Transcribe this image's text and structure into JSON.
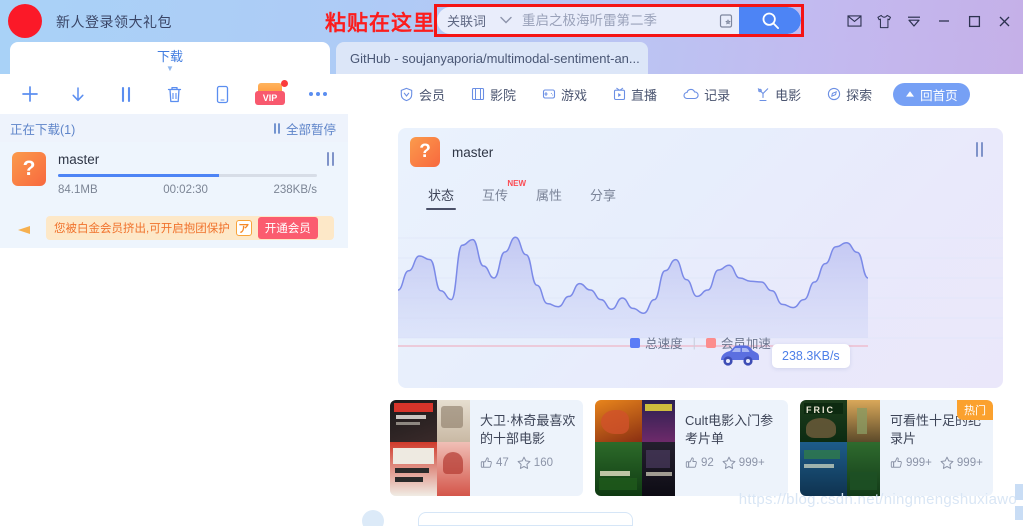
{
  "titlebar": {
    "promo_text": "新人登录领大礼包",
    "paste_hint": "粘贴在这里",
    "logo": "red-circle-logo"
  },
  "search": {
    "category": "关联词",
    "value": "",
    "placeholder": "重启之极海听雷第二季",
    "favorite_icon": "bookmark-star-icon",
    "go_icon": "search-icon"
  },
  "window_controls": [
    {
      "name": "mail-icon",
      "glyph": "✉"
    },
    {
      "name": "skin-tshirt-icon",
      "glyph": "👕"
    },
    {
      "name": "menu-chevron-icon",
      "glyph": "▽"
    },
    {
      "name": "minimize-icon",
      "glyph": "—"
    },
    {
      "name": "maximize-icon",
      "glyph": "▢"
    },
    {
      "name": "close-icon",
      "glyph": "✕"
    }
  ],
  "tabs": [
    {
      "label": "下载",
      "active": true
    },
    {
      "label": "GitHub - soujanyaporia/multimodal-sentiment-an...",
      "active": false
    }
  ],
  "left_panel": {
    "toolbar": [
      {
        "name": "add-task-button",
        "icon": "plus-icon"
      },
      {
        "name": "download-button",
        "icon": "arrow-down-icon"
      },
      {
        "name": "pause-button",
        "icon": "pause-icon"
      },
      {
        "name": "delete-button",
        "icon": "trash-icon"
      },
      {
        "name": "mobile-button",
        "icon": "phone-icon"
      },
      {
        "name": "vip-button",
        "icon": "vip-badge-icon",
        "label": "VIP"
      },
      {
        "name": "more-button",
        "icon": "ellipsis-icon"
      }
    ],
    "status_label": "正在下载(1)",
    "pause_all_label": "全部暂停",
    "download": {
      "icon_char": "?",
      "title": "master",
      "size": "84.1MB",
      "time": "00:02:30",
      "speed": "238KB/s",
      "progress_percent": 62,
      "pause_icon": "pause-icon"
    },
    "banner": {
      "text": "您被白金会员挤出,可开启抱团保护",
      "badge": "ア",
      "button_label": "开通会员"
    }
  },
  "nav": [
    {
      "label": "会员",
      "icon": "vip-shield-icon"
    },
    {
      "label": "影院",
      "icon": "film-icon"
    },
    {
      "label": "游戏",
      "icon": "gamepad-icon"
    },
    {
      "label": "直播",
      "icon": "live-tv-icon"
    },
    {
      "label": "记录",
      "icon": "cloud-icon"
    },
    {
      "label": "电影",
      "icon": "movie-icon"
    },
    {
      "label": "探索",
      "icon": "compass-icon"
    }
  ],
  "home_button": {
    "label": "回首页",
    "icon": "triangle-up-icon"
  },
  "task_card": {
    "icon_char": "?",
    "title": "master",
    "pause_icon": "pause-icon",
    "tabs": [
      {
        "label": "状态",
        "active": true,
        "badge": ""
      },
      {
        "label": "互传",
        "active": false,
        "badge": "NEW"
      },
      {
        "label": "属性",
        "active": false,
        "badge": ""
      },
      {
        "label": "分享",
        "active": false,
        "badge": ""
      }
    ],
    "speed_bubble": "238.3KB/s",
    "car_icon": "car-icon"
  },
  "chart_data": {
    "type": "area",
    "title": "",
    "xlabel": "",
    "ylabel": "",
    "legend": [
      {
        "label": "总速度",
        "color": "#5b7cf6"
      },
      {
        "label": "会员加速",
        "color": "#fc8d8d"
      }
    ],
    "legend_position": "bottom",
    "grid": true,
    "ylim": [
      0,
      300
    ],
    "current_value": 238.3,
    "unit": "KB/s",
    "series": [
      {
        "name": "总速度",
        "color": "#5b7cf6",
        "values": [
          120,
          168,
          205,
          196,
          118,
          96,
          232,
          246,
          180,
          150,
          215,
          252,
          208,
          132,
          86,
          78,
          104,
          136,
          120,
          96,
          72,
          100,
          74,
          62,
          96,
          168,
          196,
          146,
          104,
          120,
          170,
          182,
          150,
          142,
          140,
          118,
          84,
          76,
          96,
          140,
          186,
          228,
          238,
          214,
          150
        ]
      },
      {
        "name": "会员加速",
        "color": "#fc8d8d",
        "values": [
          0,
          0,
          0,
          0,
          0,
          0,
          0,
          0,
          0,
          0,
          0,
          0,
          0,
          0,
          0,
          0,
          0,
          0,
          0,
          0,
          0,
          0,
          0,
          0,
          0,
          0,
          0,
          0,
          0,
          0,
          0,
          0,
          0,
          0,
          0,
          0,
          0,
          0,
          0,
          0,
          0,
          0,
          0,
          0,
          0
        ]
      }
    ]
  },
  "movie_cards": [
    {
      "title": "大卫·林奇最喜欢的十部电影",
      "likes": "47",
      "stars": "160",
      "hot": "",
      "poster_colors": [
        "#2a2a2a",
        "#c9302c",
        "#d9d0c4",
        "#e8e3da",
        "#cf4a3a",
        "#f0c8c0"
      ]
    },
    {
      "title": "Cult电影入门参考片单",
      "likes": "92",
      "stars": "999+",
      "hot": "",
      "poster_colors": [
        "#e07b1f",
        "#3b6b2e",
        "#1e2a4a",
        "#8a2b2b",
        "#b85c10",
        "#2e2e3a"
      ]
    },
    {
      "title": "可看性十足的纪录片",
      "likes": "999+",
      "stars": "999+",
      "hot": "热门",
      "poster_colors": [
        "#1f3a1f",
        "#6e8b3d",
        "#2d5f8a",
        "#8a9a3d",
        "#3f6b2f",
        "#1a4b6e"
      ]
    }
  ],
  "watermark": "https://blog.csdn.net/ningmengshuxiawo",
  "icons": {
    "like": "thumb-up-icon",
    "star": "star-icon"
  }
}
